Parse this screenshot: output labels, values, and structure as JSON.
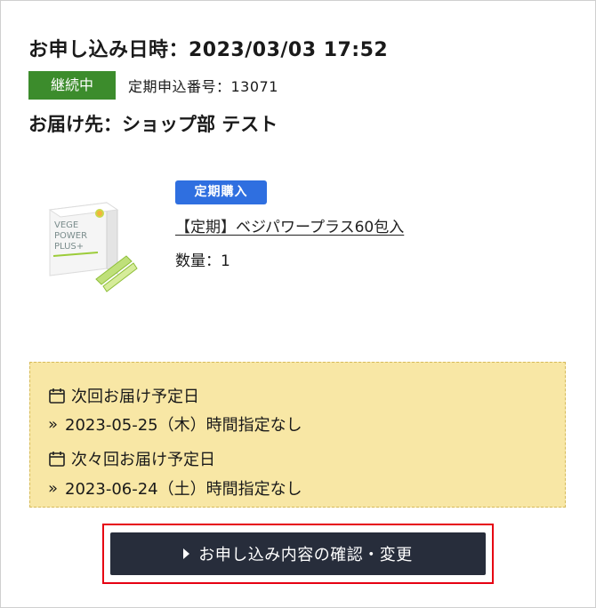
{
  "order": {
    "date_line": "お申し込み日時：2023/03/03 17:52",
    "status": "継続中",
    "subscription_number": "定期申込番号：13071",
    "recipient": "お届け先：ショップ部 テスト"
  },
  "product": {
    "type_badge": "定期購入",
    "name": "【定期】ベジパワープラス60包入",
    "quantity": "数量：1",
    "image_icon": "vege-power-plus-box-image",
    "image_text": [
      "VEGE",
      "POWER",
      "PLUS+"
    ]
  },
  "delivery": {
    "next_label": "次回お届け予定日",
    "next_value": "2023-05-25（木）時間指定なし",
    "after_next_label": "次々回お届け予定日",
    "after_next_value": "2023-06-24（土）時間指定なし",
    "icon": "calendar-icon",
    "marker": "»"
  },
  "actions": {
    "confirm_label": "お申し込み内容の確認・変更"
  },
  "colors": {
    "status_green": "#3c8c2c",
    "badge_blue": "#2f6fe0",
    "delivery_bg": "#f8e7a5",
    "button_dark": "#272d3b",
    "highlight_red": "#e60012"
  }
}
